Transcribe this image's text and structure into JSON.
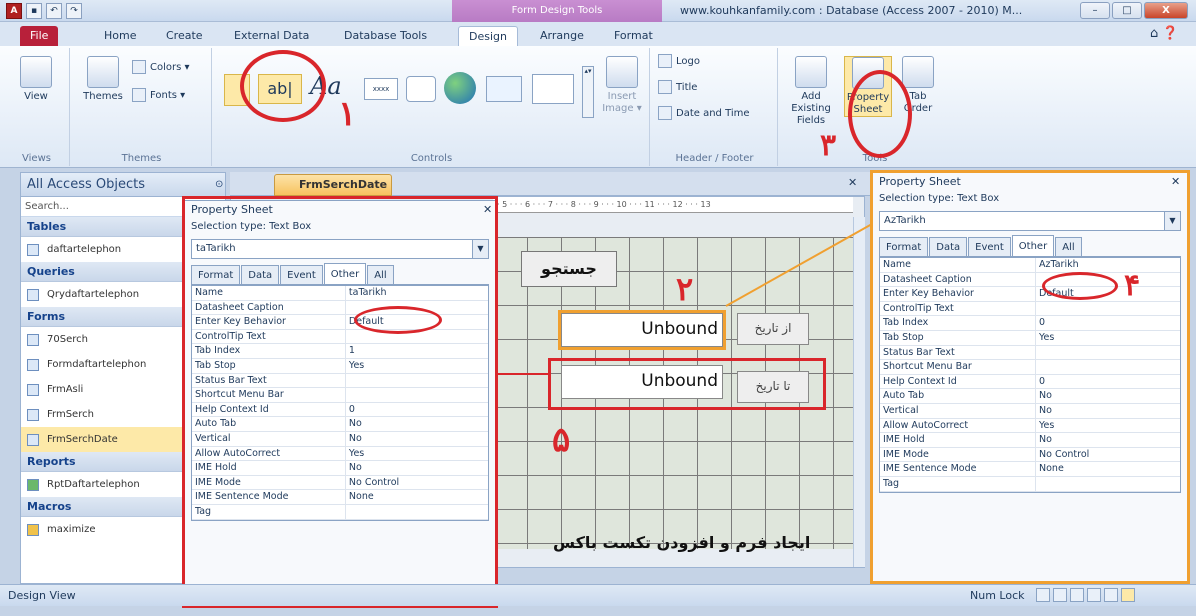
{
  "window": {
    "contextual_group": "Form Design Tools",
    "title": "www.kouhkanfamily.com : Database (Access 2007 - 2010) M...",
    "controls": [
      "–",
      "□",
      "X"
    ]
  },
  "qat": {
    "app_icon": "A",
    "undo": "↶",
    "redo": "↷"
  },
  "tabs": [
    "File",
    "Home",
    "Create",
    "External Data",
    "Database Tools",
    "Design",
    "Arrange",
    "Format"
  ],
  "ribbon": {
    "views": {
      "view_label": "View",
      "group": "Views"
    },
    "themes": {
      "themes_label": "Themes",
      "colors_label": "Colors ▾",
      "fonts_label": "Fonts ▾",
      "group": "Themes"
    },
    "controls": {
      "textbox_glyph": "ab|",
      "label_glyph": "Aa",
      "group": "Controls",
      "insert_image": "Insert Image ▾"
    },
    "header_footer": {
      "logo": "Logo",
      "title": "Title",
      "date_time": "Date and Time",
      "group": "Header / Footer"
    },
    "tools": {
      "add_fields": "Add Existing Fields",
      "property_sheet": "Property Sheet",
      "tab_order": "Tab Order",
      "group": "Tools"
    }
  },
  "annotations": {
    "n1": "۱",
    "n2": "۲",
    "n3": "۳",
    "n4": "۴",
    "n5": "۵"
  },
  "nav": {
    "header": "All Access Objects",
    "search": "Search...",
    "sections": [
      {
        "title": "Tables",
        "items": [
          "daftartelephon"
        ]
      },
      {
        "title": "Queries",
        "items": [
          "Qrydaftartelephon"
        ]
      },
      {
        "title": "Forms",
        "items": [
          "70Serch",
          "Formdaftartelephon",
          "FrmAsli",
          "FrmSerch",
          "FrmSerchDate"
        ]
      },
      {
        "title": "Reports",
        "items": [
          "RptDaftartelephon"
        ]
      },
      {
        "title": "Macros",
        "items": [
          "maximize"
        ]
      }
    ]
  },
  "doc_tab": "FrmSerchDate",
  "form": {
    "search_label": "جستجو",
    "unbound1": "Unbound",
    "label1": "از تاریخ",
    "unbound2": "Unbound",
    "label2": "تا تاریخ",
    "caption": "ایجاد فرم و افزودن تکست باکس"
  },
  "ps_left": {
    "title": "Property Sheet",
    "selection": "Selection type:  Text Box",
    "combo": "taTarikh",
    "tabs": [
      "Format",
      "Data",
      "Event",
      "Other",
      "All"
    ],
    "rows": [
      [
        "Name",
        "taTarikh"
      ],
      [
        "Datasheet Caption",
        ""
      ],
      [
        "Enter Key Behavior",
        "Default"
      ],
      [
        "ControlTip Text",
        ""
      ],
      [
        "Tab Index",
        "1"
      ],
      [
        "Tab Stop",
        "Yes"
      ],
      [
        "Status Bar Text",
        ""
      ],
      [
        "Shortcut Menu Bar",
        ""
      ],
      [
        "Help Context Id",
        "0"
      ],
      [
        "Auto Tab",
        "No"
      ],
      [
        "Vertical",
        "No"
      ],
      [
        "Allow AutoCorrect",
        "Yes"
      ],
      [
        "IME Hold",
        "No"
      ],
      [
        "IME Mode",
        "No Control"
      ],
      [
        "IME Sentence Mode",
        "None"
      ],
      [
        "Tag",
        ""
      ]
    ]
  },
  "ps_right": {
    "title": "Property Sheet",
    "selection": "Selection type:  Text Box",
    "combo": "AzTarikh",
    "tabs": [
      "Format",
      "Data",
      "Event",
      "Other",
      "All"
    ],
    "rows": [
      [
        "Name",
        "AzTarikh"
      ],
      [
        "Datasheet Caption",
        ""
      ],
      [
        "Enter Key Behavior",
        "Default"
      ],
      [
        "ControlTip Text",
        ""
      ],
      [
        "Tab Index",
        "0"
      ],
      [
        "Tab Stop",
        "Yes"
      ],
      [
        "Status Bar Text",
        ""
      ],
      [
        "Shortcut Menu Bar",
        ""
      ],
      [
        "Help Context Id",
        "0"
      ],
      [
        "Auto Tab",
        "No"
      ],
      [
        "Vertical",
        "No"
      ],
      [
        "Allow AutoCorrect",
        "Yes"
      ],
      [
        "IME Hold",
        "No"
      ],
      [
        "IME Mode",
        "No Control"
      ],
      [
        "IME Sentence Mode",
        "None"
      ],
      [
        "Tag",
        ""
      ]
    ]
  },
  "status": {
    "left": "Design View",
    "right": "Num Lock"
  },
  "colors": {
    "annotation_red": "#d9262b",
    "annotation_orange": "#f0a030",
    "file_tab": "#b8203a"
  }
}
